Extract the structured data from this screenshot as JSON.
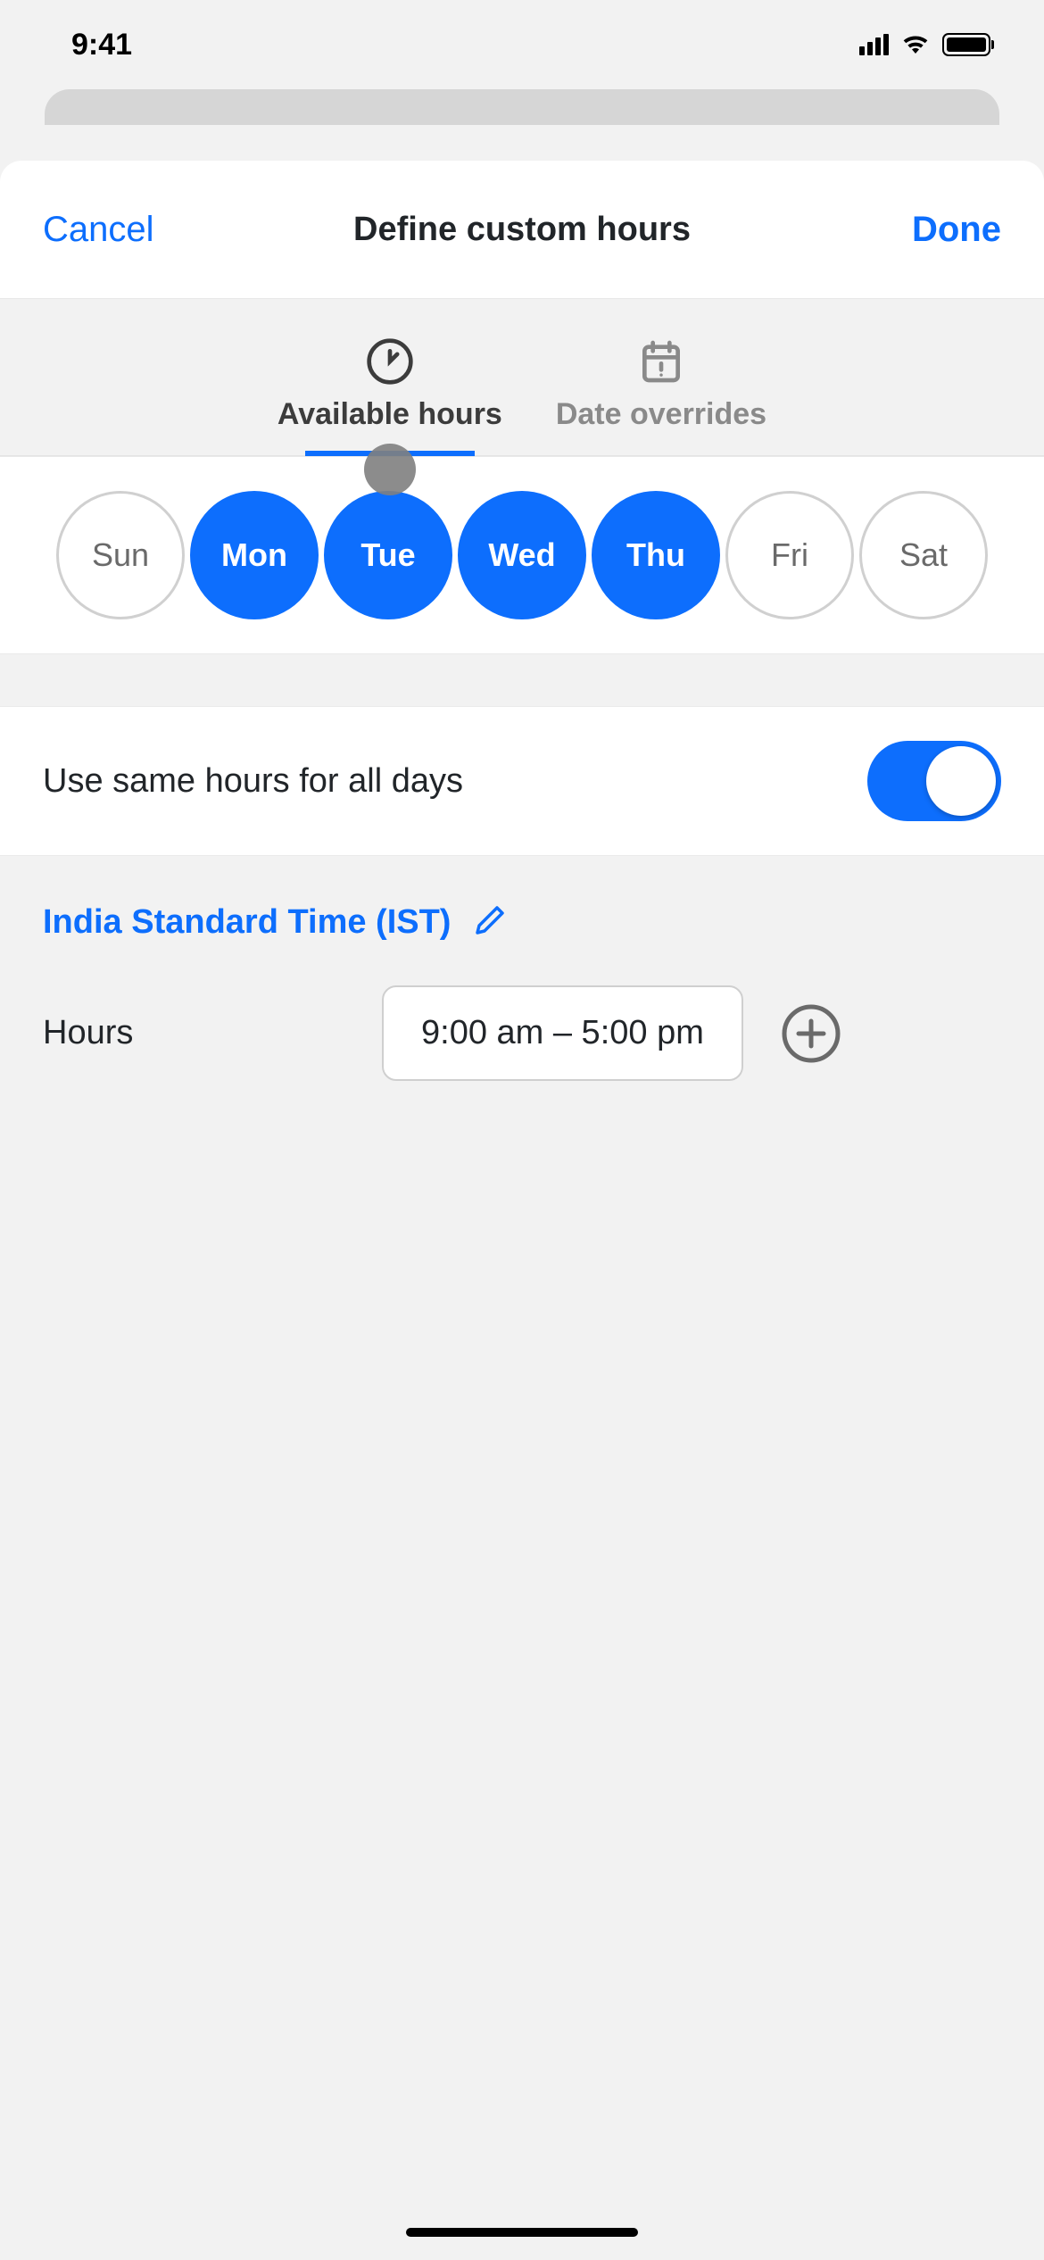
{
  "status": {
    "time": "9:41"
  },
  "header": {
    "cancel": "Cancel",
    "title": "Define custom hours",
    "done": "Done"
  },
  "tabs": [
    {
      "label": "Available hours",
      "active": true
    },
    {
      "label": "Date overrides",
      "active": false
    }
  ],
  "days": [
    {
      "label": "Sun",
      "selected": false
    },
    {
      "label": "Mon",
      "selected": true
    },
    {
      "label": "Tue",
      "selected": true
    },
    {
      "label": "Wed",
      "selected": true
    },
    {
      "label": "Thu",
      "selected": true
    },
    {
      "label": "Fri",
      "selected": false
    },
    {
      "label": "Sat",
      "selected": false
    }
  ],
  "sameHours": {
    "label": "Use same hours for all days",
    "value": true
  },
  "timezone": {
    "label": "India Standard Time (IST)"
  },
  "hours": {
    "label": "Hours",
    "range": "9:00 am – 5:00 pm"
  }
}
